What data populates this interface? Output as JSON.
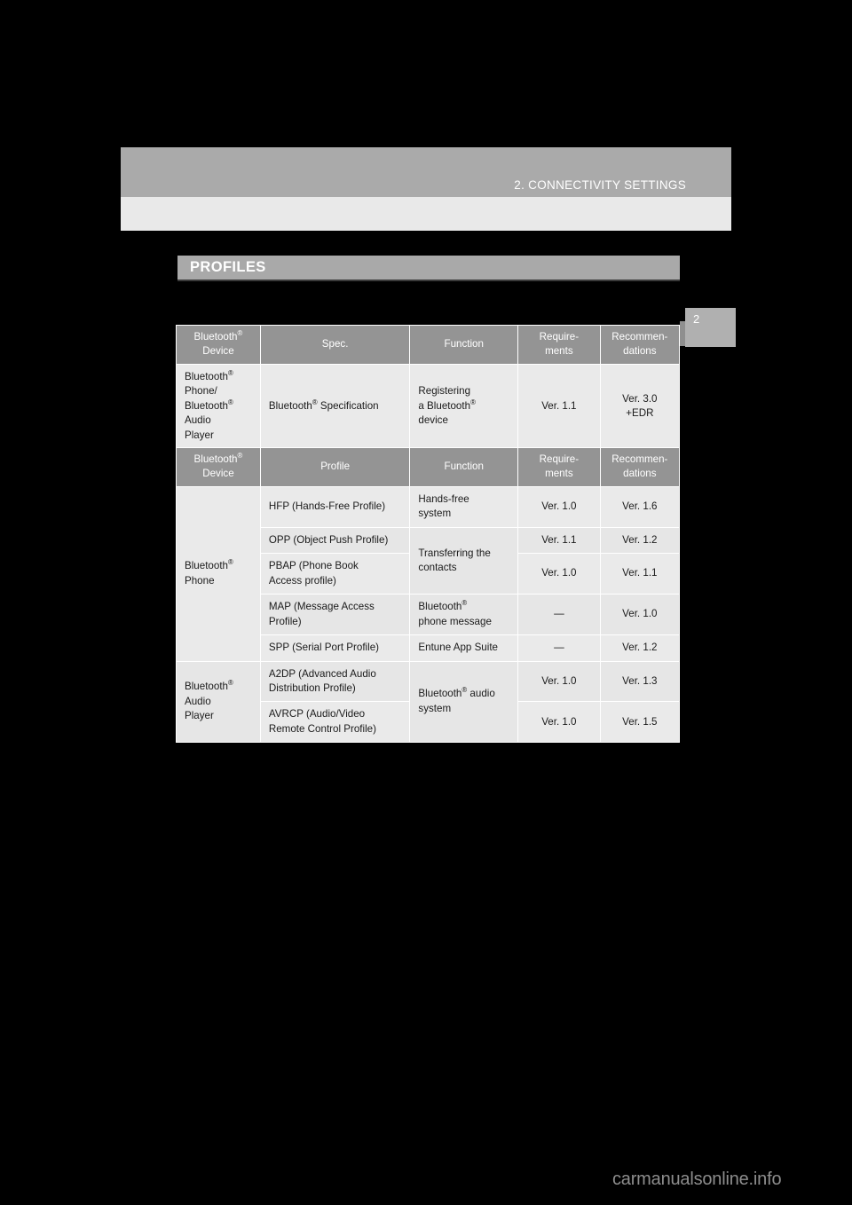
{
  "page": {
    "header_title": "2. CONNECTIVITY SETTINGS",
    "chapter_tab_number": "2",
    "section_title": "PROFILES",
    "footer_watermark": "carmanualsonline.info",
    "background_color": "#000000",
    "header_band_color": "#aaaaaa",
    "header_subband_color": "#e9e9e9",
    "section_bar_color": "#a9a9a9",
    "table_header_color": "#949494",
    "table_cell_color": "#eaeaea"
  },
  "tables": [
    {
      "id": "spec-table",
      "headers": [
        "Bluetooth® Device",
        "Spec.",
        "Function",
        "Require- ments",
        "Recommen- dations"
      ],
      "header_parts": {
        "device_line1": "Bluetooth",
        "device_sup": "®",
        "device_line2": "Device",
        "col2": "Spec.",
        "col3": "Function",
        "col4_line1": "Require-",
        "col4_line2": "ments",
        "col5_line1": "Recommen-",
        "col5_line2": "dations"
      },
      "rows": [
        {
          "device_lines": [
            "Bluetooth®",
            "Phone/",
            "Bluetooth®",
            "Audio",
            "Player"
          ],
          "spec": "Bluetooth® Specification",
          "function_lines": [
            "Registering",
            "a Bluetooth®",
            "device"
          ],
          "requirements": "Ver. 1.1",
          "recommendations_lines": [
            "Ver. 3.0",
            "+EDR"
          ]
        }
      ]
    },
    {
      "id": "profile-table",
      "header_parts": {
        "device_line1": "Bluetooth",
        "device_sup": "®",
        "device_line2": "Device",
        "col2": "Profile",
        "col3": "Function",
        "col4_line1": "Require-",
        "col4_line2": "ments",
        "col5_line1": "Recommen-",
        "col5_line2": "dations"
      },
      "device_groups": [
        {
          "label_lines": [
            "Bluetooth®",
            "Phone"
          ],
          "rowspan": 5
        },
        {
          "label_lines": [
            "Bluetooth®",
            "Audio",
            "Player"
          ],
          "rowspan": 2
        }
      ],
      "rows": [
        {
          "profile": "HFP (Hands-Free Profile)",
          "function_lines": [
            "Hands-free",
            "system"
          ],
          "function_rowspan": 1,
          "requirements": "Ver. 1.0",
          "recommendations": "Ver. 1.6"
        },
        {
          "profile": "OPP (Object Push Profile)",
          "function_lines": [
            "Transferring the",
            "contacts"
          ],
          "function_rowspan": 2,
          "requirements": "Ver. 1.1",
          "recommendations": "Ver. 1.2"
        },
        {
          "profile": "PBAP (Phone Book Access profile)",
          "profile_lines": [
            "PBAP (Phone Book",
            "Access profile)"
          ],
          "requirements": "Ver. 1.0",
          "recommendations": "Ver. 1.1"
        },
        {
          "profile": "MAP (Message Access Profile)",
          "profile_lines": [
            "MAP (Message Access",
            "Profile)"
          ],
          "function_lines": [
            "Bluetooth®",
            "phone message"
          ],
          "function_rowspan": 1,
          "requirements": "—",
          "recommendations": "Ver. 1.0"
        },
        {
          "profile": "SPP (Serial Port Profile)",
          "function_lines": [
            "Entune App Suite"
          ],
          "function_rowspan": 1,
          "requirements": "—",
          "recommendations": "Ver. 1.2"
        },
        {
          "profile": "A2DP (Advanced Audio Distribution Profile)",
          "profile_lines": [
            "A2DP (Advanced Audio",
            "Distribution Profile)"
          ],
          "function_lines": [
            "Bluetooth® audio",
            "system"
          ],
          "function_rowspan": 2,
          "requirements": "Ver. 1.0",
          "recommendations": "Ver. 1.3"
        },
        {
          "profile": "AVRCP (Audio/Video Remote Control Profile)",
          "profile_lines": [
            "AVRCP (Audio/Video",
            "Remote Control Profile)"
          ],
          "requirements": "Ver. 1.0",
          "recommendations": "Ver. 1.5"
        }
      ]
    }
  ]
}
